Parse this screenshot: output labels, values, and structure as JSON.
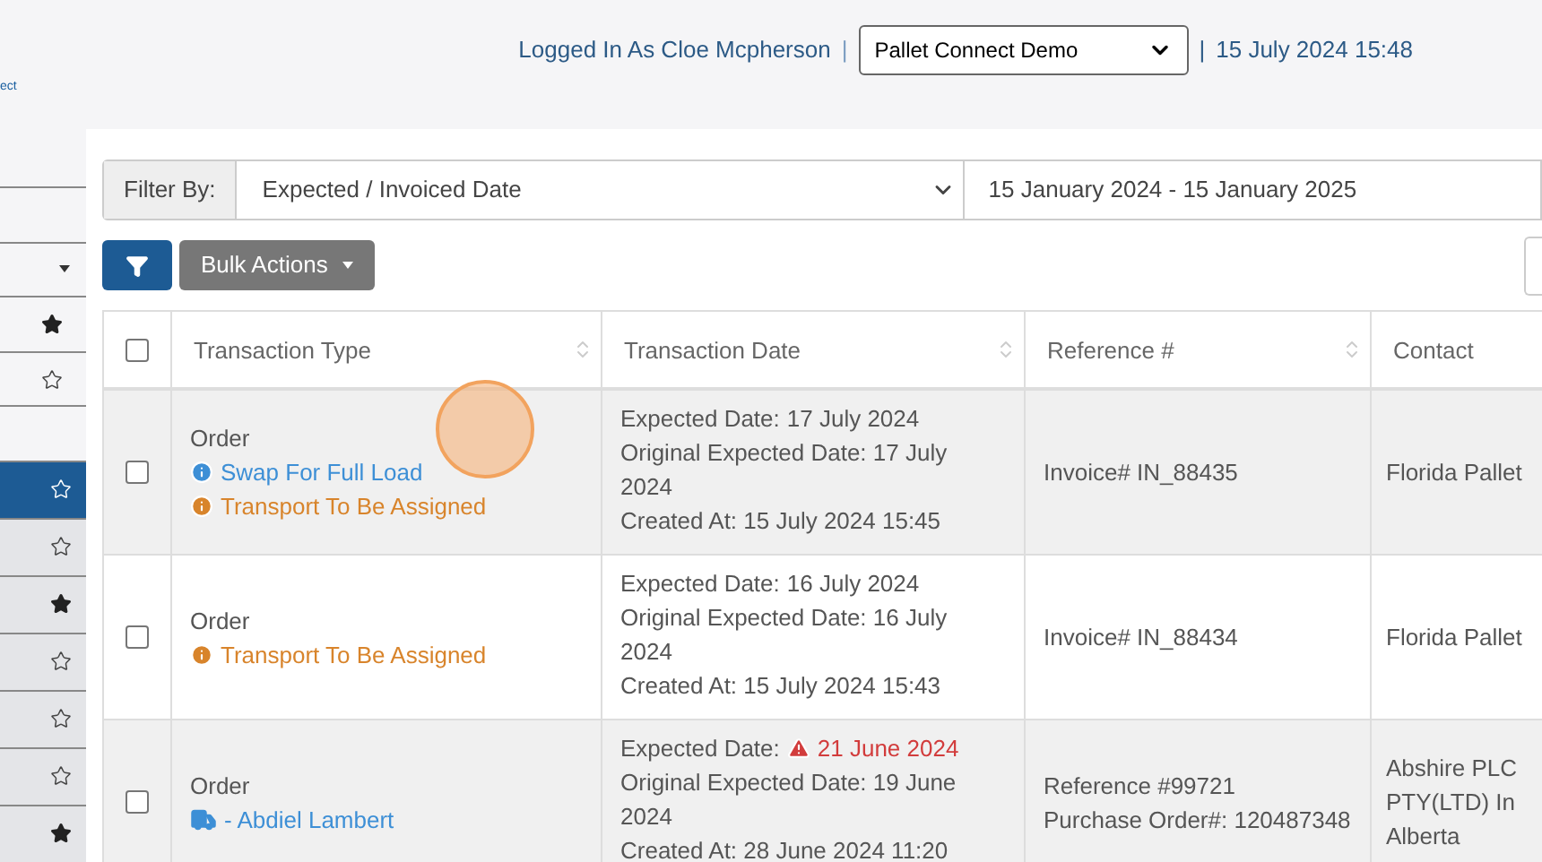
{
  "logo": {
    "text": "ect"
  },
  "header": {
    "logged_in": "Logged In As Cloe Mcpherson",
    "separator_left": "|",
    "account_select": {
      "value": "Pallet Connect Demo"
    },
    "separator_right": "|",
    "datetime": "15 July 2024 15:48"
  },
  "sidebar": {
    "top_items": [
      {
        "kind": "blank"
      },
      {
        "kind": "dropdown"
      },
      {
        "kind": "star",
        "starred": true
      },
      {
        "kind": "star",
        "starred": false
      },
      {
        "kind": "blank"
      }
    ],
    "menu_items": [
      {
        "starred": false,
        "selected": true
      },
      {
        "starred": false,
        "selected": false
      },
      {
        "starred": true,
        "selected": false
      },
      {
        "starred": false,
        "selected": false
      },
      {
        "starred": false,
        "selected": false
      },
      {
        "starred": false,
        "selected": false
      },
      {
        "starred": true,
        "selected": false
      }
    ]
  },
  "filter": {
    "label": "Filter By:",
    "field": {
      "value": "Expected / Invoiced Date"
    },
    "date_range": {
      "value": "15 January 2024 - 15 January 2025"
    }
  },
  "toolbar": {
    "bulk_actions": "Bulk Actions"
  },
  "table": {
    "header_checkbox": {
      "checked": false
    },
    "columns": [
      {
        "label": "Transaction Type",
        "sortable": true
      },
      {
        "label": "Transaction Date",
        "sortable": true
      },
      {
        "label": "Reference #",
        "sortable": true
      },
      {
        "label": "Contact"
      }
    ],
    "rows": [
      {
        "checked": false,
        "shaded": true,
        "type": "Order",
        "tags": [
          {
            "kind": "info",
            "text": "Swap For Full Load"
          },
          {
            "kind": "warning",
            "text": "Transport To Be Assigned"
          }
        ],
        "expected_label": "Expected Date:",
        "expected": "17 July 2024",
        "overdue": false,
        "original": "Original Expected Date: 17 July 2024",
        "created": "Created At: 15 July 2024 15:45",
        "reference": [
          "Invoice# IN_88435"
        ],
        "contact": [
          "Florida Pallet"
        ]
      },
      {
        "checked": false,
        "shaded": false,
        "type": "Order",
        "tags": [
          {
            "kind": "warning",
            "text": "Transport To Be Assigned"
          }
        ],
        "expected_label": "Expected Date:",
        "expected": "16 July 2024",
        "overdue": false,
        "original": "Original Expected Date: 16 July 2024",
        "created": "Created At: 15 July 2024 15:43",
        "reference": [
          "Invoice# IN_88434"
        ],
        "contact": [
          "Florida Pallet"
        ]
      },
      {
        "checked": false,
        "shaded": true,
        "type": "Order",
        "tags": [
          {
            "kind": "driver",
            "text": "- Abdiel Lambert"
          }
        ],
        "expected_label": "Expected Date:",
        "expected": "21 June 2024",
        "overdue": true,
        "original": "Original Expected Date: 19 June 2024",
        "created": "Created At: 28 June 2024 11:20",
        "reference": [
          "Reference #99721",
          "Purchase Order#: 120487348"
        ],
        "contact": [
          "Abshire PLC",
          "PTY(LTD) In",
          "Alberta"
        ]
      }
    ]
  }
}
